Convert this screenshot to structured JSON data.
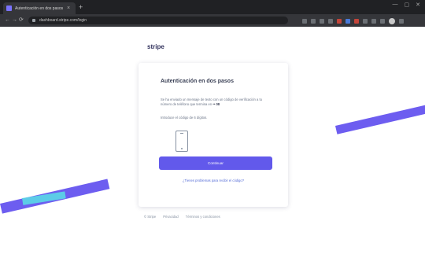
{
  "browser": {
    "tab_title": "Autenticación en dos pasos",
    "tab_close": "×",
    "new_tab": "+",
    "url": "dashboard.stripe.com/login",
    "window_controls": [
      "—",
      "▢",
      "✕"
    ],
    "nav": [
      "←",
      "→",
      "⟳"
    ]
  },
  "page": {
    "brand": "stripe",
    "card": {
      "title": "Autenticación en dos pasos",
      "desc_prefix": "Se ha enviado un mensaje de texto con un código de verificación a tu número de teléfono que termina en ",
      "phone_suffix": "•• 08",
      "hint": "Introduce el código de 6 dígitos.",
      "button_label": "Continuar",
      "alt_link": "¿Tienes problemas para recibir el código?"
    },
    "footer": {
      "links": [
        "© Stripe",
        "Privacidad",
        "Términos y condiciones"
      ]
    }
  },
  "colors": {
    "accent": "#6259eb",
    "stripe_band": "#6d5df0",
    "cyan_band": "#5ad8e6",
    "chrome_bg": "#202124"
  }
}
